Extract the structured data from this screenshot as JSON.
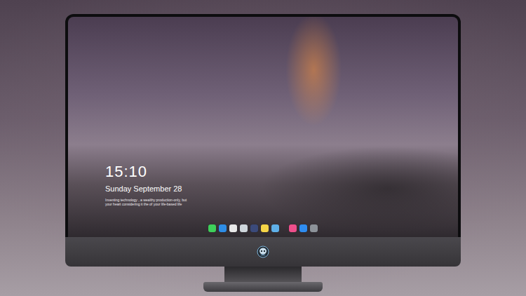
{
  "desktop": {
    "time": "15:10",
    "date": "Sunday September 28",
    "quote": [
      "Inventing technology , a wealthy production-only, but",
      "your heart considering it the of your life-based life"
    ]
  },
  "dock": {
    "groups": [
      [
        {
          "color": "#3ecf5a"
        },
        {
          "color": "#2e8de6"
        },
        {
          "color": "#e8e8e8"
        },
        {
          "color": "#cfd6dc"
        },
        {
          "color": "#3b4a7a"
        },
        {
          "color": "#f5d547"
        },
        {
          "color": "#5fb0e8"
        }
      ],
      [
        {
          "color": "#ee4f8b"
        },
        {
          "color": "#2f8cf0"
        },
        {
          "color": "#8d9299"
        }
      ]
    ]
  }
}
